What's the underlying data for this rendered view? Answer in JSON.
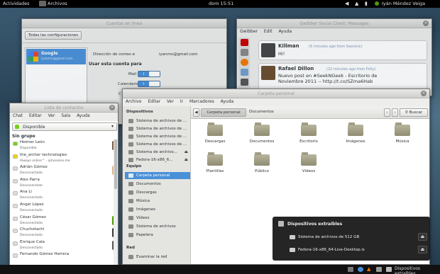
{
  "topbar": {
    "activities": "Actividades",
    "app_name": "Archivos",
    "clock": "dom 15:51",
    "user": "Iyán Méndez Veiga"
  },
  "online_accounts": {
    "title": "Cuentas en línea",
    "all_button": "Todas las configuraciones",
    "account_name": "Google",
    "account_sub": "iyanmv@gmail.com",
    "email_label": "Dirección de correo-e",
    "email_value": "iyanmv@gmail.com",
    "use_heading": "Usar esta cuenta para",
    "mail_label": "Mail",
    "calendar_label": "Calendario",
    "partial_label": "C",
    "toggle_on": "I"
  },
  "gwibber": {
    "title": "Gwibber Social Client: Messages",
    "menu": [
      "Gwibber",
      "Edit",
      "Ayuda"
    ],
    "posts": [
      {
        "name": "Killman",
        "meta": "(6 minutes ago from Seesmic)",
        "text": "Hi!"
      },
      {
        "name": "Rafael Dillon",
        "meta": "(22 minutes ago from Polly)",
        "text": "Nuevo post en #SeekNGeek - Escritorio de Noviembre 2011 -- http://t.co/SZma6Hab"
      }
    ]
  },
  "empathy": {
    "title": "Lista de contactos",
    "menu": [
      "Chat",
      "Editar",
      "Ver",
      "Sala",
      "Ayuda"
    ],
    "status": "Disponible",
    "group": "Sin grupo",
    "contacts": [
      {
        "name": "Heimer León",
        "status": "Disponible",
        "color": "#73d216"
      },
      {
        "name": "the_archer technologies",
        "status": "Always online™ - iphoneino.me",
        "color": "#edd400"
      },
      {
        "name": "Adrián Gómez",
        "status": "Desconectado",
        "color": "#ddd"
      },
      {
        "name": "Alex Parra",
        "status": "Desconectado",
        "color": "#ddd"
      },
      {
        "name": "Ana Li",
        "status": "Desconectado",
        "color": "#ddd"
      },
      {
        "name": "Angel López",
        "status": "Desconectado",
        "color": "#ddd"
      },
      {
        "name": "César Gómez",
        "status": "Desconectado",
        "color": "#ddd"
      },
      {
        "name": "Chuchotachi",
        "status": "Desconectado",
        "color": "#ddd"
      },
      {
        "name": "Enrique Cala",
        "status": "Desconectado",
        "color": "#ddd"
      },
      {
        "name": "Fernando Gómez Herrera",
        "status": "",
        "color": "#ddd"
      }
    ]
  },
  "nautilus": {
    "title": "Carpeta personal",
    "menu": [
      "Archivo",
      "Editar",
      "Ver",
      "Ir",
      "Marcadores",
      "Ayuda"
    ],
    "path_active": "Carpeta personal",
    "path_next": "Documentos",
    "search": "Buscar",
    "devices_heading": "Dispositivos",
    "devices": [
      "Sistema de archivos de ...",
      "Sistema de archivos de ...",
      "Sistema de archivos de ...",
      "Sistema de archivos de ...",
      "Sistema de archivo...",
      "Fedora-16-x86_6..."
    ],
    "equipo_heading": "Equipo",
    "places": [
      "Carpeta personal",
      "Documentos",
      "Descargas",
      "Música",
      "Imágenes",
      "Vídeos",
      "Sistema de archivos",
      "Papelera"
    ],
    "red_heading": "Red",
    "network": [
      "Examinar la red"
    ],
    "folders": [
      "Descargas",
      "Documentos",
      "Escritorio",
      "Imágenes",
      "Música",
      "Plantillas",
      "Público",
      "Vídeos"
    ]
  },
  "notification": {
    "title": "Dispositivos extraíbles",
    "items": [
      "Sistema de archivos de 512 GB",
      "Fedora-16-x86_64-Live-Desktop.is"
    ]
  },
  "tray": {
    "label": "Dispositivos extraíbles"
  },
  "colors": {
    "accent": "#4a90d9",
    "gwibber_link": "#3465a4"
  }
}
